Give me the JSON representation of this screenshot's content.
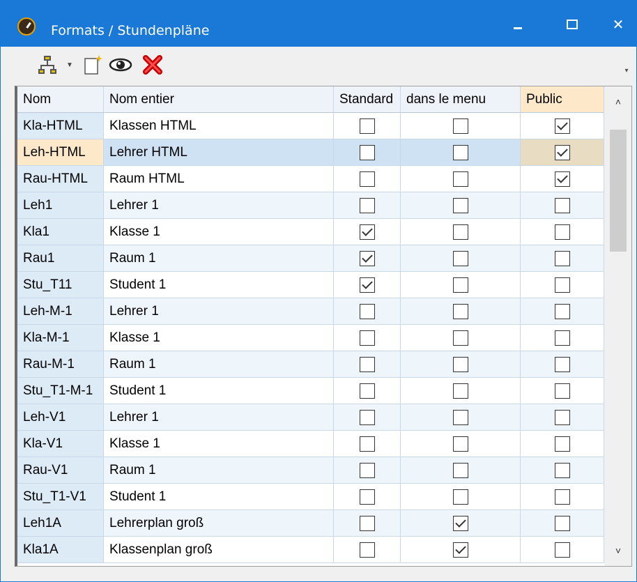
{
  "window": {
    "title": "Formats / Stundenpläne",
    "controls": {
      "minimize": "–",
      "maximize": "☐",
      "close": "✕"
    }
  },
  "toolbar": {
    "items": [
      "network-icon",
      "dropdown-arrow-icon",
      "new-document-icon",
      "eye-icon",
      "delete-icon"
    ],
    "overflow": "▾"
  },
  "grid": {
    "columns": [
      "Nom",
      "Nom entier",
      "Standard",
      "dans le menu",
      "Public"
    ],
    "rows": [
      {
        "nom": "Kla-HTML",
        "full": "Klassen HTML",
        "standard": false,
        "menu": false,
        "public": true
      },
      {
        "nom": "Leh-HTML",
        "full": "Lehrer HTML",
        "standard": false,
        "menu": false,
        "public": true
      },
      {
        "nom": "Rau-HTML",
        "full": "Raum HTML",
        "standard": false,
        "menu": false,
        "public": true
      },
      {
        "nom": "Leh1",
        "full": "Lehrer 1",
        "standard": false,
        "menu": false,
        "public": false
      },
      {
        "nom": "Kla1",
        "full": "Klasse 1",
        "standard": true,
        "menu": false,
        "public": false
      },
      {
        "nom": "Rau1",
        "full": "Raum 1",
        "standard": true,
        "menu": false,
        "public": false
      },
      {
        "nom": "Stu_T11",
        "full": "Student 1",
        "standard": true,
        "menu": false,
        "public": false
      },
      {
        "nom": "Leh-M-1",
        "full": "Lehrer 1",
        "standard": false,
        "menu": false,
        "public": false
      },
      {
        "nom": "Kla-M-1",
        "full": "Klasse 1",
        "standard": false,
        "menu": false,
        "public": false
      },
      {
        "nom": "Rau-M-1",
        "full": "Raum 1",
        "standard": false,
        "menu": false,
        "public": false
      },
      {
        "nom": "Stu_T1-M-1",
        "full": "Student 1",
        "standard": false,
        "menu": false,
        "public": false
      },
      {
        "nom": "Leh-V1",
        "full": "Lehrer 1",
        "standard": false,
        "menu": false,
        "public": false
      },
      {
        "nom": "Kla-V1",
        "full": "Klasse 1",
        "standard": false,
        "menu": false,
        "public": false
      },
      {
        "nom": "Rau-V1",
        "full": "Raum 1",
        "standard": false,
        "menu": false,
        "public": false
      },
      {
        "nom": "Stu_T1-V1",
        "full": "Student 1",
        "standard": false,
        "menu": false,
        "public": false
      },
      {
        "nom": "Leh1A",
        "full": "Lehrerplan groß",
        "standard": false,
        "menu": true,
        "public": false
      },
      {
        "nom": "Kla1A",
        "full": "Klassenplan groß",
        "standard": false,
        "menu": true,
        "public": false
      }
    ],
    "selected_row_index": 1
  },
  "scrollbar": {
    "up": "˄",
    "down": "˅"
  },
  "colors": {
    "titlebar": "#1a78d6",
    "selection": "#cfe2f3",
    "highlight": "#fde9c9"
  }
}
